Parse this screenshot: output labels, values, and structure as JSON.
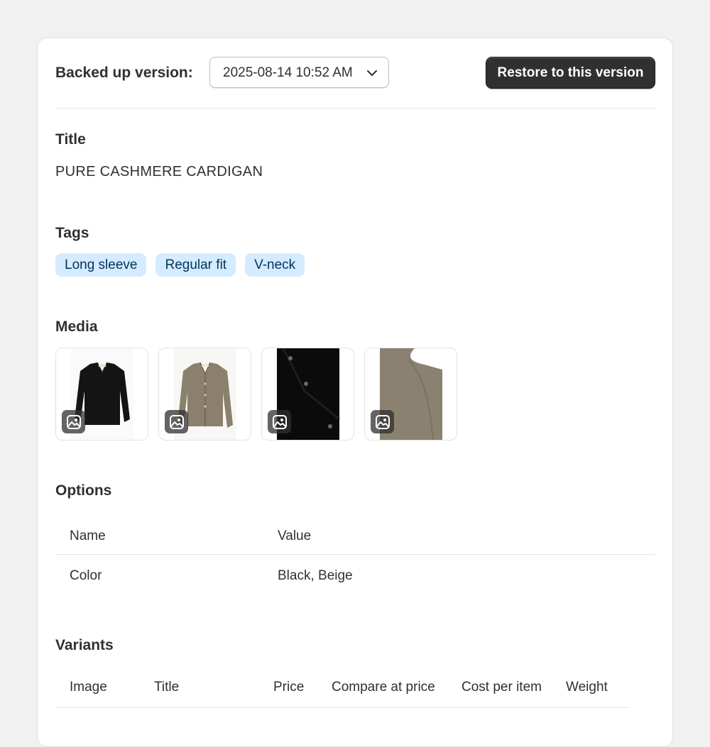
{
  "header": {
    "backup_label": "Backed up version:",
    "version_selected": "2025-08-14 10:52 AM",
    "restore_button": "Restore to this version"
  },
  "sections": {
    "title_heading": "Title",
    "title_value": "PURE CASHMERE CARDIGAN",
    "tags_heading": "Tags",
    "tags": [
      "Long sleeve",
      "Regular fit",
      "V-neck"
    ],
    "media_heading": "Media",
    "options_heading": "Options",
    "variants_heading": "Variants"
  },
  "options_table": {
    "columns": [
      "Name",
      "Value"
    ],
    "rows": [
      [
        "Color",
        "Black, Beige"
      ]
    ]
  },
  "variants_table": {
    "columns": [
      "Image",
      "Title",
      "Price",
      "Compare at price",
      "Cost per item",
      "Weight"
    ]
  },
  "media": [
    {
      "icon": "image-icon",
      "description_color": "#111111"
    },
    {
      "icon": "image-icon",
      "description_color": "#8a7f6b"
    },
    {
      "icon": "image-icon",
      "description_color": "#0a0a0a"
    },
    {
      "icon": "image-icon",
      "description_color": "#8b8270"
    }
  ],
  "colors": {
    "tag_bg": "#d5ebff",
    "tag_text": "#00345c",
    "primary_button": "#303030",
    "page_bg": "#f1f1f1"
  }
}
